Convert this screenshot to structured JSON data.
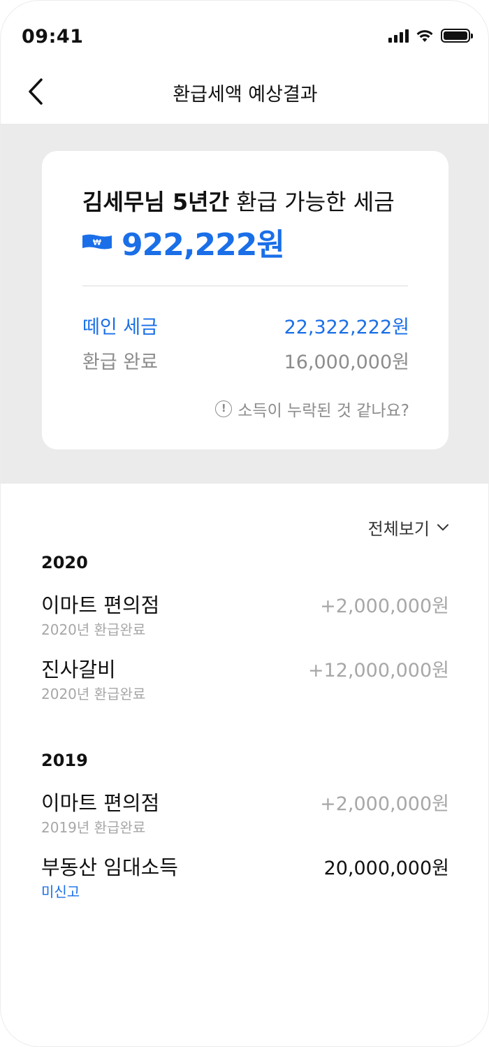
{
  "status_bar": {
    "time": "09:41"
  },
  "nav": {
    "title": "환급세액 예상결과"
  },
  "summary": {
    "heading_name": "김세무님 5년간",
    "heading_rest": " 환급 가능한 세금",
    "total": "922,222원",
    "paid_label": "떼인 세금",
    "paid_value": "22,322,222원",
    "refunded_label": "환급 완료",
    "refunded_value": "16,000,000원",
    "help_text": "소득이 누락된 것 같나요?",
    "accent_color": "#1a6fe8"
  },
  "list": {
    "view_all_label": "전체보기",
    "years": [
      {
        "year": "2020",
        "entries": [
          {
            "name": "이마트 편의점",
            "sub": "2020년 환급완료",
            "amount": "+2,000,000원"
          },
          {
            "name": "진사갈비",
            "sub": "2020년 환급완료",
            "amount": "+12,000,000원"
          }
        ]
      },
      {
        "year": "2019",
        "entries": [
          {
            "name": "이마트 편의점",
            "sub": "2019년 환급완료",
            "amount": "+2,000,000원"
          },
          {
            "name": "부동산 임대소득",
            "sub": "미신고",
            "amount": "20,000,000원"
          }
        ]
      }
    ]
  }
}
